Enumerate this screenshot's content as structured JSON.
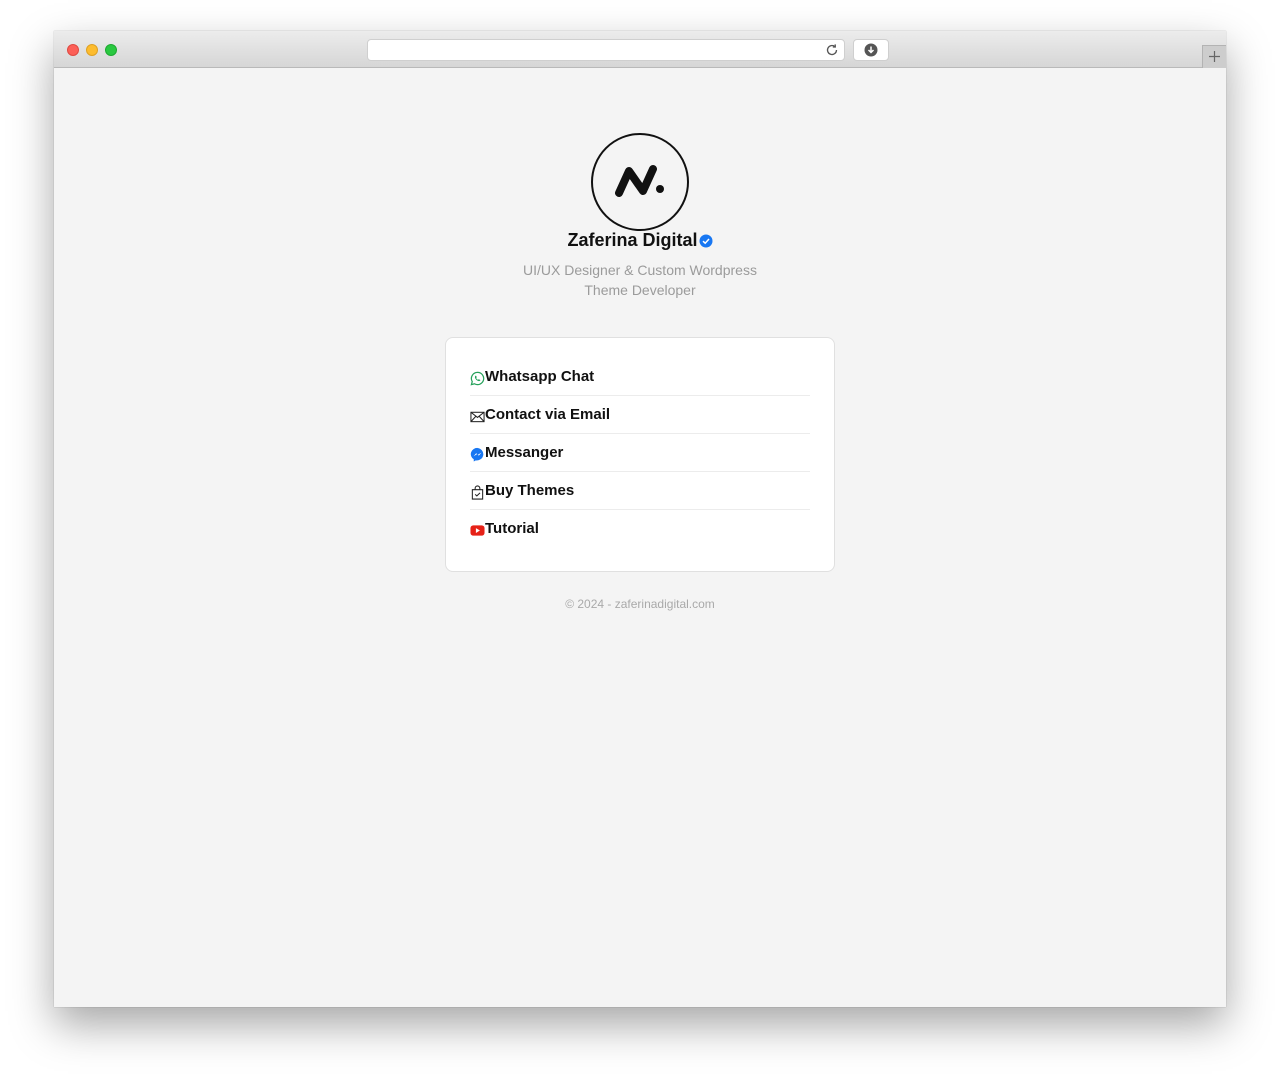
{
  "browser": {
    "url_value": "",
    "icons": {
      "reload": "reload-icon",
      "download": "download-icon",
      "new_tab": "plus-icon"
    }
  },
  "profile": {
    "name": "Zaferina Digital",
    "verified_icon": "verified-badge-icon",
    "bio_line1": "UI/UX Designer & Custom Wordpress",
    "bio_line2": "Theme Developer"
  },
  "links": [
    {
      "label": "Whatsapp Chat",
      "icon": "whatsapp-icon",
      "icon_color": "#25a05a"
    },
    {
      "label": "Contact via Email",
      "icon": "envelope-icon",
      "icon_color": "#222222"
    },
    {
      "label": "Messanger",
      "icon": "messenger-icon",
      "icon_color": "#1877f2"
    },
    {
      "label": "Buy Themes",
      "icon": "shopping-bag-icon",
      "icon_color": "#222222"
    },
    {
      "label": "Tutorial",
      "icon": "youtube-icon",
      "icon_color": "#e62117"
    }
  ],
  "footer": {
    "text": "© 2024 - zaferinadigital.com"
  },
  "colors": {
    "page_bg": "#f4f4f4",
    "card_bg": "#ffffff",
    "verified_blue": "#1877f2",
    "muted_text": "#9b9b9b"
  }
}
